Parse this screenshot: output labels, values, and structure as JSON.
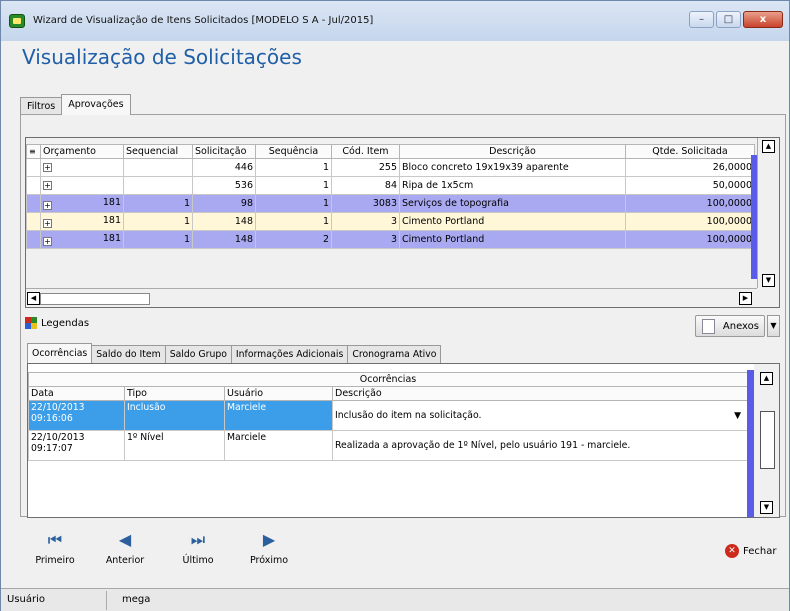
{
  "window": {
    "title": "Wizard de Visualização de Itens Solicitados [MODELO S A - Jul/2015]",
    "controls": {
      "minimize": "–",
      "maximize": "□",
      "close": "x"
    }
  },
  "page_title": "Visualização de Solicitações",
  "tabs": [
    {
      "label": "Filtros",
      "active": false
    },
    {
      "label": "Aprovações",
      "active": true
    }
  ],
  "requests_grid": {
    "columns": [
      "Orçamento",
      "Sequencial",
      "Solicitação",
      "Sequência",
      "Cód. Item",
      "Descrição",
      "Qtde. Solicitada"
    ],
    "rows": [
      {
        "orcamento": "",
        "sequencial": "",
        "solicitacao": "446",
        "sequencia": "1",
        "cod_item": "255",
        "descricao": "Bloco concreto 19x19x39 aparente",
        "qtde": "26,0000"
      },
      {
        "orcamento": "",
        "sequencial": "",
        "solicitacao": "536",
        "sequencia": "1",
        "cod_item": "84",
        "descricao": "Ripa de 1x5cm",
        "qtde": "50,0000"
      },
      {
        "orcamento": "181",
        "sequencial": "1",
        "solicitacao": "98",
        "sequencia": "1",
        "cod_item": "3083",
        "descricao": "Serviços de topografia",
        "qtde": "100,0000"
      },
      {
        "orcamento": "181",
        "sequencial": "1",
        "solicitacao": "148",
        "sequencia": "1",
        "cod_item": "3",
        "descricao": "Cimento Portland",
        "qtde": "100,0000"
      },
      {
        "orcamento": "181",
        "sequencial": "1",
        "solicitacao": "148",
        "sequencia": "2",
        "cod_item": "3",
        "descricao": "Cimento Portland",
        "qtde": "100,0000"
      }
    ]
  },
  "legendas_label": "Legendas",
  "legend_colors": [
    "#cc2a1b",
    "#2a8a2a",
    "#2b5fd0",
    "#e8c020"
  ],
  "anexos_label": "Anexos",
  "subtabs": [
    {
      "label": "Ocorrências",
      "active": true
    },
    {
      "label": "Saldo do Item",
      "active": false
    },
    {
      "label": "Saldo Grupo",
      "active": false
    },
    {
      "label": "Informações Adicionais",
      "active": false
    },
    {
      "label": "Cronograma Ativo",
      "active": false
    }
  ],
  "occurrences_grid": {
    "group_header": "Ocorrências",
    "columns": [
      "Data",
      "Tipo",
      "Usuário",
      "Descrição"
    ],
    "rows": [
      {
        "data": "22/10/2013 09:16:06",
        "tipo": "Inclusão",
        "usuario": "Marciele",
        "descricao": "Inclusão do item na solicitação."
      },
      {
        "data": "22/10/2013 09:17:07",
        "tipo": "1º Nível",
        "usuario": "Marciele",
        "descricao": "Realizada a aprovação de 1º Nível, pelo usuário 191 - marciele."
      }
    ]
  },
  "nav": {
    "primeiro": "Primeiro",
    "anterior": "Anterior",
    "ultimo": "Último",
    "proximo": "Próximo",
    "fechar": "Fechar"
  },
  "status": {
    "label": "Usuário",
    "value": "mega"
  }
}
